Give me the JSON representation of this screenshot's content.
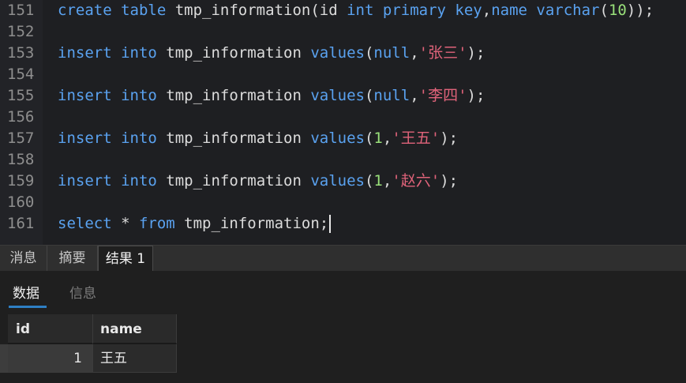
{
  "editor": {
    "lines": [
      {
        "no": "151",
        "tokens": [
          {
            "t": "create",
            "c": "kw"
          },
          {
            "t": " "
          },
          {
            "t": "table",
            "c": "kw"
          },
          {
            "t": " tmp_information("
          },
          {
            "t": "id"
          },
          {
            "t": " "
          },
          {
            "t": "int",
            "c": "kw"
          },
          {
            "t": " "
          },
          {
            "t": "primary",
            "c": "kw"
          },
          {
            "t": " "
          },
          {
            "t": "key",
            "c": "kw"
          },
          {
            "t": ","
          },
          {
            "t": "name",
            "c": "kw"
          },
          {
            "t": " "
          },
          {
            "t": "varchar",
            "c": "kw"
          },
          {
            "t": "("
          },
          {
            "t": "10",
            "c": "num"
          },
          {
            "t": "));"
          }
        ]
      },
      {
        "no": "152",
        "tokens": []
      },
      {
        "no": "153",
        "tokens": [
          {
            "t": "insert",
            "c": "kw"
          },
          {
            "t": " "
          },
          {
            "t": "into",
            "c": "kw"
          },
          {
            "t": " tmp_information "
          },
          {
            "t": "values",
            "c": "kw"
          },
          {
            "t": "("
          },
          {
            "t": "null",
            "c": "kw"
          },
          {
            "t": ","
          },
          {
            "t": "'张三'",
            "c": "str"
          },
          {
            "t": ");"
          }
        ]
      },
      {
        "no": "154",
        "tokens": []
      },
      {
        "no": "155",
        "tokens": [
          {
            "t": "insert",
            "c": "kw"
          },
          {
            "t": " "
          },
          {
            "t": "into",
            "c": "kw"
          },
          {
            "t": " tmp_information "
          },
          {
            "t": "values",
            "c": "kw"
          },
          {
            "t": "("
          },
          {
            "t": "null",
            "c": "kw"
          },
          {
            "t": ","
          },
          {
            "t": "'李四'",
            "c": "str"
          },
          {
            "t": ");"
          }
        ]
      },
      {
        "no": "156",
        "tokens": []
      },
      {
        "no": "157",
        "tokens": [
          {
            "t": "insert",
            "c": "kw"
          },
          {
            "t": " "
          },
          {
            "t": "into",
            "c": "kw"
          },
          {
            "t": " tmp_information "
          },
          {
            "t": "values",
            "c": "kw"
          },
          {
            "t": "("
          },
          {
            "t": "1",
            "c": "num"
          },
          {
            "t": ","
          },
          {
            "t": "'王五'",
            "c": "str"
          },
          {
            "t": ");"
          }
        ]
      },
      {
        "no": "158",
        "tokens": []
      },
      {
        "no": "159",
        "tokens": [
          {
            "t": "insert",
            "c": "kw"
          },
          {
            "t": " "
          },
          {
            "t": "into",
            "c": "kw"
          },
          {
            "t": " tmp_information "
          },
          {
            "t": "values",
            "c": "kw"
          },
          {
            "t": "("
          },
          {
            "t": "1",
            "c": "num"
          },
          {
            "t": ","
          },
          {
            "t": "'赵六'",
            "c": "str"
          },
          {
            "t": ");"
          }
        ]
      },
      {
        "no": "160",
        "tokens": []
      },
      {
        "no": "161",
        "tokens": [
          {
            "t": "select",
            "c": "kw"
          },
          {
            "t": " * "
          },
          {
            "t": "from",
            "c": "kw"
          },
          {
            "t": " tmp_information;"
          }
        ]
      }
    ]
  },
  "result_tabs": {
    "messages": "消息",
    "summary": "摘要",
    "result1": "结果 1"
  },
  "panel": {
    "data_tab": "数据",
    "info_tab": "信息"
  },
  "grid": {
    "columns": [
      "id",
      "name"
    ],
    "rows": [
      {
        "id": "1",
        "name": "王五"
      }
    ]
  },
  "colors": {
    "keyword": "#5aa2f0",
    "number": "#99e07a",
    "string": "#e0637a",
    "accent": "#2e7fc4"
  }
}
